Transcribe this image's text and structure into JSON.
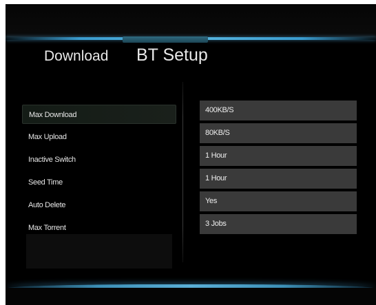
{
  "tabs": [
    {
      "label": "Download"
    },
    {
      "label": "BT Setup"
    }
  ],
  "settings": [
    {
      "label": "Max Download",
      "value": "400KB/S"
    },
    {
      "label": "Max Upload",
      "value": "80KB/S"
    },
    {
      "label": "Inactive Switch",
      "value": "1 Hour"
    },
    {
      "label": "Seed Time",
      "value": "1 Hour"
    },
    {
      "label": "Auto Delete",
      "value": "Yes"
    },
    {
      "label": "Max Torrent",
      "value": "3 Jobs"
    }
  ],
  "colors": {
    "accent": "#3a9ccf",
    "row_value_bg": "#3a3a3a",
    "background": "#000000"
  }
}
